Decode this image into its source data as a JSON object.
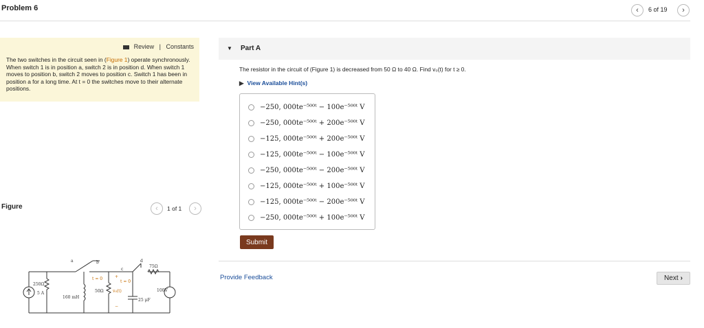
{
  "header": {
    "title": "Problem 6",
    "page_indicator": "6 of 19",
    "prev_icon": "chevron-left-icon",
    "next_icon": "chevron-right-icon"
  },
  "intro": {
    "review_label": "Review",
    "separator": "|",
    "constants_label": "Constants",
    "text_before": "The two switches in the circuit seen in (",
    "figure_link": "Figure 1",
    "text_after": ") operate synchronously. When switch 1 is in position a, switch 2 is in position d. When switch 1 moves to position b, switch 2 moves to position c. Switch 1 has been in position a for a long time. At t = 0 the switches move to their alternate positions."
  },
  "figure": {
    "title": "Figure",
    "pager": "1 of 1",
    "circuit_labels": {
      "a": "a",
      "b": "b",
      "c": "c",
      "d": "d",
      "r250": "250Ω",
      "src": "5 A",
      "ind": "160 mH",
      "t0a": "t = 0",
      "r50": "50Ω",
      "vo": "v₀(t)",
      "t0b": "t = 0",
      "r75": "75Ω",
      "cap": "25 μF",
      "vs": "100V",
      "plus": "+",
      "minus": "−"
    }
  },
  "part": {
    "label": "Part A",
    "question": "The resistor in the circuit of (Figure 1) is decreased from 50 Ω to 40 Ω. Find v₀(t) for t ≥ 0.",
    "hints_label": "View Available Hint(s)",
    "choices": [
      "−250, 000te⁻⁵⁰⁰ᵗ − 100e⁻⁵⁰⁰ᵗ V",
      "−250, 000te⁻⁵⁰⁰ᵗ + 200e⁻⁵⁰⁰ᵗ V",
      "−125, 000te⁻⁵⁰⁰ᵗ + 200e⁻⁵⁰⁰ᵗ V",
      "−125, 000te⁻⁵⁰⁰ᵗ − 100e⁻⁵⁰⁰ᵗ V",
      "−250, 000te⁻⁵⁰⁰ᵗ − 200e⁻⁵⁰⁰ᵗ V",
      "−125, 000te⁻⁵⁰⁰ᵗ + 100e⁻⁵⁰⁰ᵗ V",
      "−125, 000te⁻⁵⁰⁰ᵗ − 200e⁻⁵⁰⁰ᵗ V",
      "−250, 000te⁻⁵⁰⁰ᵗ + 100e⁻⁵⁰⁰ᵗ V"
    ],
    "submit_label": "Submit"
  },
  "footer": {
    "feedback_label": "Provide Feedback",
    "next_label": "Next"
  }
}
